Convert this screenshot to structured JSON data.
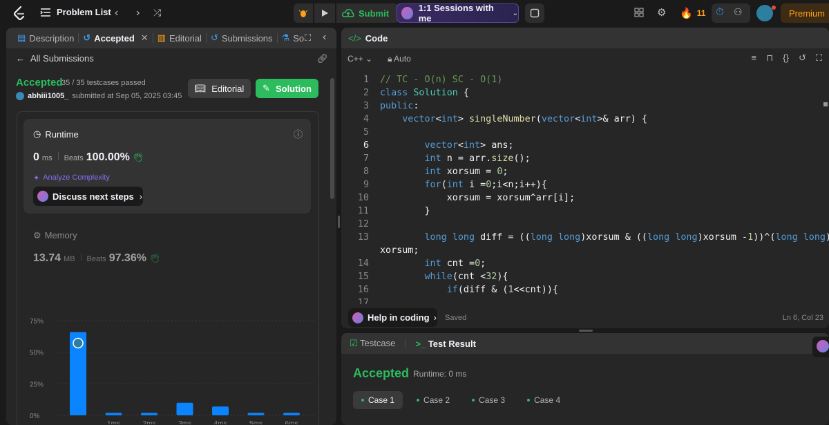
{
  "topbar": {
    "problem_list": "Problem List",
    "submit": "Submit",
    "sessions": "1:1 Sessions with me",
    "streak": "11",
    "premium": "Premium"
  },
  "left_tabs": {
    "description": "Description",
    "accepted": "Accepted",
    "editorial": "Editorial",
    "submissions": "Submissions",
    "solutions": "So"
  },
  "submission": {
    "all_submissions": "All Submissions",
    "status": "Accepted",
    "passed": "35 / 35 testcases passed",
    "user": "abhiii1005_",
    "submitted_at": "submitted at Sep 05, 2025 03:45",
    "editorial_btn": "Editorial",
    "solution_btn": "Solution"
  },
  "runtime": {
    "label": "Runtime",
    "value": "0",
    "unit": "ms",
    "beats_label": "Beats",
    "beats": "100.00%",
    "analyze": "Analyze Complexity",
    "discuss": "Discuss next steps"
  },
  "memory": {
    "label": "Memory",
    "value": "13.74",
    "unit": "MB",
    "beats_label": "Beats",
    "beats": "97.36%"
  },
  "chart_data": {
    "type": "bar",
    "categories": [
      "0ms",
      "1ms",
      "2ms",
      "3ms",
      "4ms",
      "5ms",
      "6ms"
    ],
    "tick_labels": [
      "",
      "1ms",
      "2ms",
      "3ms",
      "4ms",
      "5ms",
      "6ms"
    ],
    "values": [
      66,
      2,
      2,
      10,
      7,
      2,
      2
    ],
    "yticks": [
      "0%",
      "25%",
      "50%",
      "75%"
    ],
    "ylim": [
      0,
      75
    ],
    "color": "#0a84ff"
  },
  "editor": {
    "title": "Code",
    "language": "C++",
    "mode": "Auto",
    "help": "Help in coding",
    "saved": "Saved",
    "cursor": "Ln 6, Col 23"
  },
  "bottom": {
    "testcase_tab": "Testcase",
    "result_tab": "Test Result",
    "status": "Accepted",
    "runtime": "Runtime: 0 ms",
    "cases": [
      "Case 1",
      "Case 2",
      "Case 3",
      "Case 4"
    ]
  }
}
